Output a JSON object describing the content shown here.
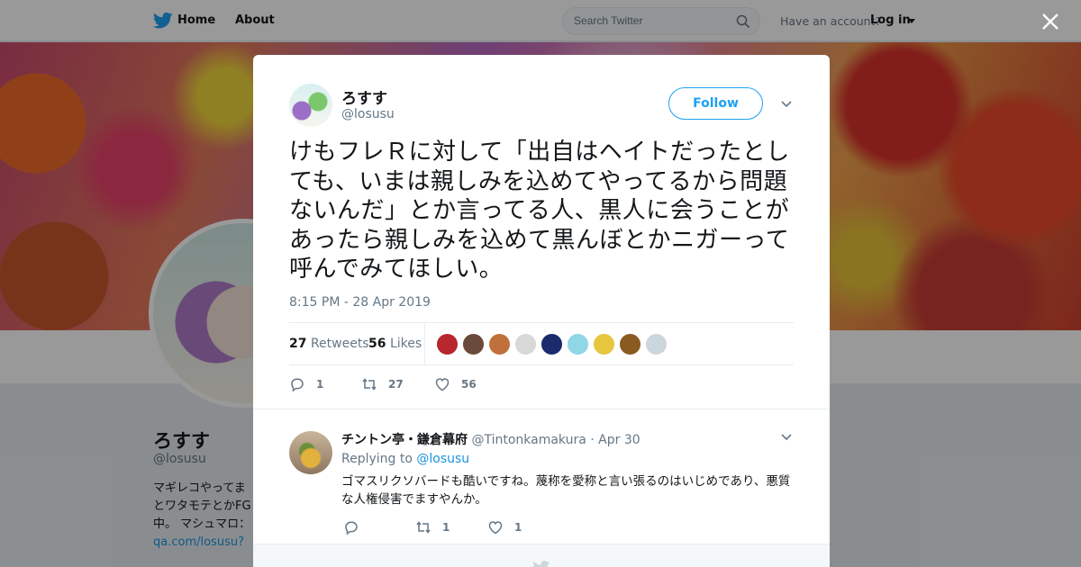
{
  "nav": {
    "home_label": "Home",
    "about_label": "About",
    "search_placeholder": "Search Twitter",
    "have_account": "Have an account?",
    "login_label": "Log in"
  },
  "colors": {
    "accent": "#1da1f2",
    "link": "#1b95e0",
    "muted": "#657786",
    "text": "#14171a"
  },
  "profile": {
    "name": "ろすす",
    "handle": "@losusu",
    "bio_line1": "マギレコやってま",
    "bio_line2": "とワタモテとかFG",
    "bio_line3": "中。 マシュマロ：",
    "bio_link": "qa.com/losusu?utm"
  },
  "tweet": {
    "author_name": "ろすす",
    "author_handle": "@losusu",
    "follow_label": "Follow",
    "text": "けもフレＲに対して「出自はヘイトだったとしても、いまは親しみを込めてやってるから問題ないんだ」とか言ってる人、黒人に会うことがあったら親しみを込めて黒んぼとかニガーって呼んでみてほしい。",
    "timestamp": "8:15 PM - 28 Apr 2019",
    "retweets_count": "27",
    "retweets_label": "Retweets",
    "likes_count": "56",
    "likes_label": "Likes",
    "actions": {
      "reply_count": "1",
      "retweet_count": "27",
      "like_count": "56"
    }
  },
  "likers": [
    {
      "color": "#b8262e"
    },
    {
      "color": "#6a4a3a"
    },
    {
      "color": "#c0703a"
    },
    {
      "color": "#d8d8d8"
    },
    {
      "color": "#1a2a6c"
    },
    {
      "color": "#8fd6e6"
    },
    {
      "color": "#e6c63c"
    },
    {
      "color": "#8a5a20"
    },
    {
      "color": "#ccd6dd"
    }
  ],
  "reply": {
    "author_name": "チントン亭・鎌倉幕府",
    "author_handle": "@Tintonkamakura",
    "date": "· Apr 30",
    "replying_to_label": "Replying to",
    "replying_to_handle": "@losusu",
    "text": "ゴマスリクソバードも酷いですね。蔑称を愛称と言い張るのはいじめであり、悪質な人権侵害でますやんか。",
    "reply_count": "",
    "retweet_count": "1",
    "like_count": "1"
  }
}
